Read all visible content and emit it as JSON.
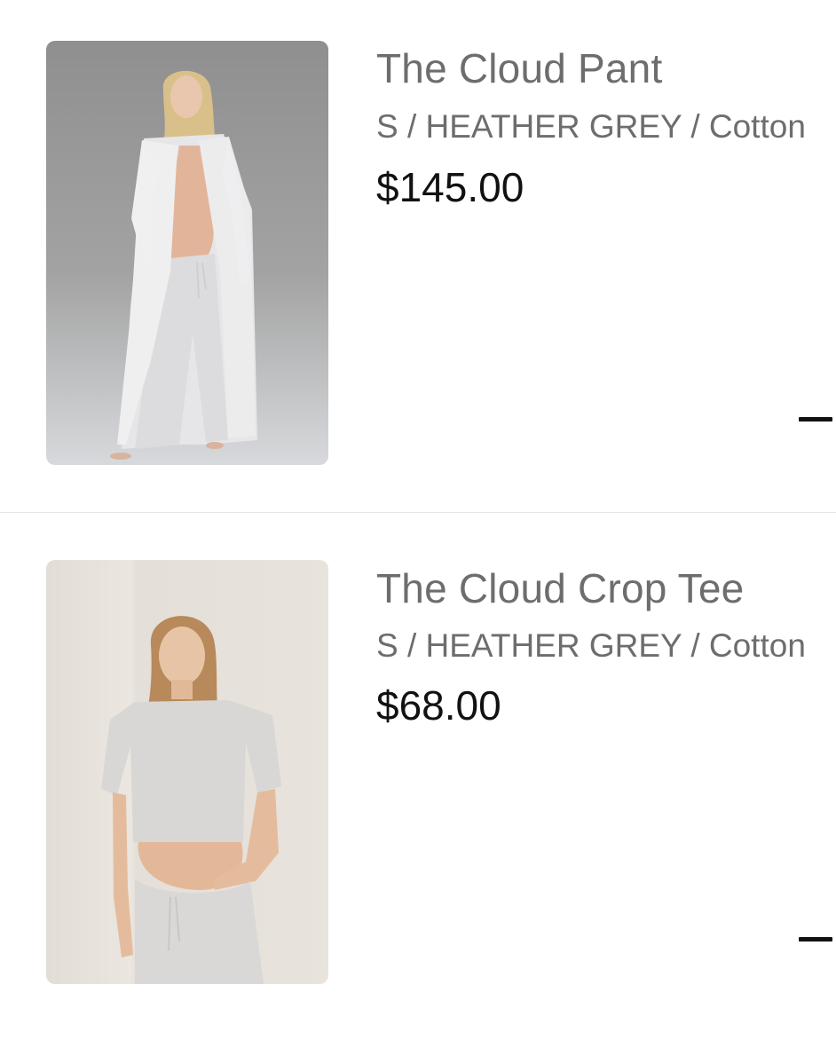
{
  "cart_items": [
    {
      "title": "The Cloud Pant",
      "variant": "S / HEATHER GREY / Cotton",
      "price": "$145.00",
      "image_alt": "Pregnant model wearing heather grey robe and wide-leg pants"
    },
    {
      "title": "The Cloud Crop Tee",
      "variant": "S / HEATHER GREY / Cotton",
      "price": "$68.00",
      "image_alt": "Pregnant model wearing heather grey crop tee and joggers"
    }
  ],
  "icons": {
    "decrease_quantity": "minus-icon"
  },
  "colors": {
    "title_text": "#6d6d6d",
    "price_text": "#111111",
    "divider": "#e6e6e6",
    "minus_icon": "#111111"
  }
}
